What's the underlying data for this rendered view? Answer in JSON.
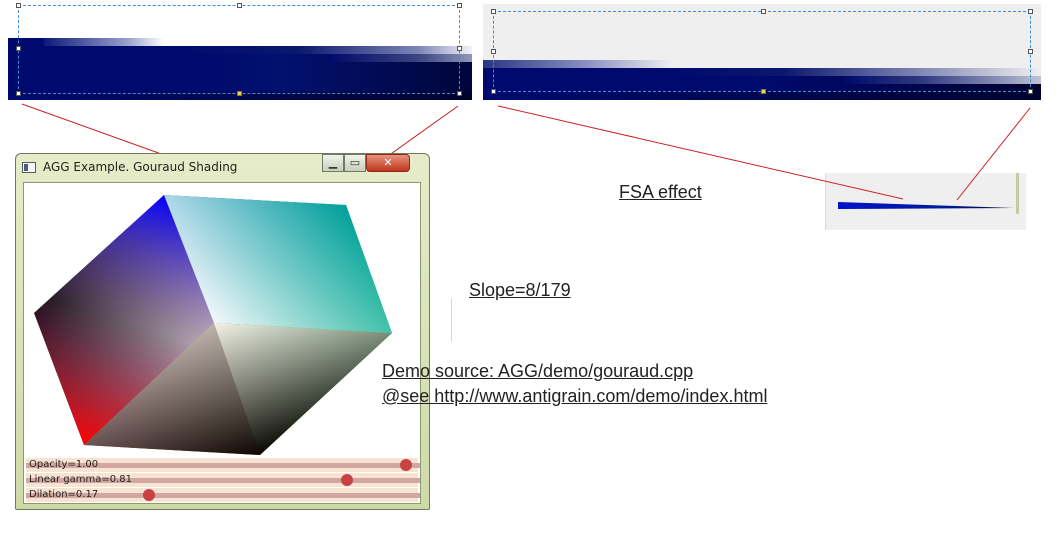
{
  "window": {
    "title": "AGG Example. Gouraud Shading",
    "buttons": {
      "minimize": "▁",
      "maximize": "▭",
      "close": "✕"
    },
    "sliders": [
      {
        "label": "Opacity=1.00",
        "value": 1.0
      },
      {
        "label": "Linear gamma=0.81",
        "value": 0.81
      },
      {
        "label": "Dilation=0.17",
        "value": 0.17
      }
    ]
  },
  "annotations": {
    "fsa": "FSA effect",
    "slope": "Slope=8/179",
    "demo_source": "Demo source: AGG/demo/gouraud.cpp",
    "see_link": "@see http://www.antigrain.com/demo/index.html"
  },
  "colors": {
    "navy": "#000a6e",
    "dark_navy": "#00053a",
    "connector": "#cc2020",
    "selection": "#3b8fd6"
  }
}
